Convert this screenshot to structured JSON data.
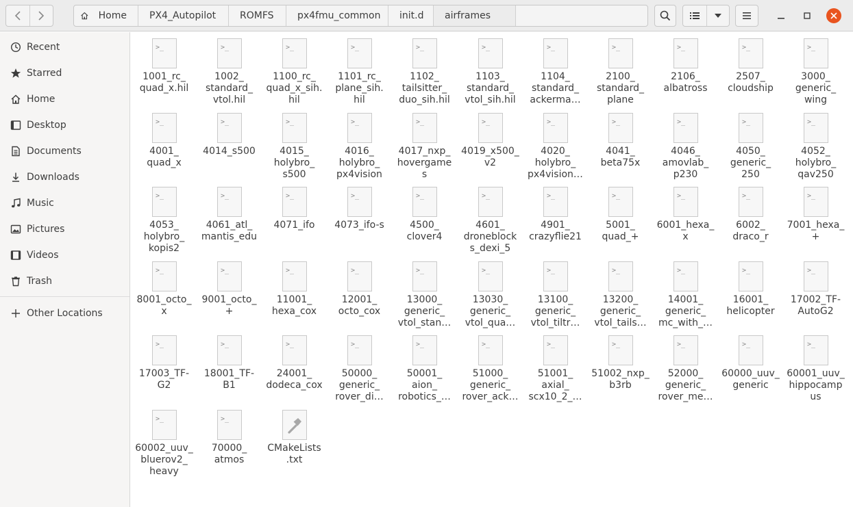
{
  "toolbar": {
    "back_label": "Back",
    "forward_label": "Forward"
  },
  "breadcrumbs": [
    "Home",
    "PX4_Autopilot",
    "ROMFS",
    "px4fmu_common",
    "init.d",
    "airframes"
  ],
  "sidebar": {
    "items": [
      {
        "label": "Recent",
        "icon": "clock-icon"
      },
      {
        "label": "Starred",
        "icon": "star-icon"
      },
      {
        "label": "Home",
        "icon": "home-icon"
      },
      {
        "label": "Desktop",
        "icon": "desktop-icon"
      },
      {
        "label": "Documents",
        "icon": "document-icon"
      },
      {
        "label": "Downloads",
        "icon": "download-icon"
      },
      {
        "label": "Music",
        "icon": "music-icon"
      },
      {
        "label": "Pictures",
        "icon": "pictures-icon"
      },
      {
        "label": "Videos",
        "icon": "video-icon"
      },
      {
        "label": "Trash",
        "icon": "trash-icon"
      }
    ],
    "other_locations": "Other Locations"
  },
  "files": [
    "1001_rc_\nquad_x.hil",
    "1002_\nstandard_\nvtol.hil",
    "1100_rc_\nquad_x_sih.\nhil",
    "1101_rc_\nplane_sih.\nhil",
    "1102_\ntailsitter_\nduo_sih.hil",
    "1103_\nstandard_\nvtol_sih.hil",
    "1104_\nstandard_\nackerma…",
    "2100_\nstandard_\nplane",
    "2106_\nalbatross",
    "2507_\ncloudship",
    "3000_\ngeneric_\nwing",
    "4001_\nquad_x",
    "4014_s500",
    "4015_\nholybro_\ns500",
    "4016_\nholybro_\npx4vision",
    "4017_nxp_\nhovergame\ns",
    "4019_x500_\nv2",
    "4020_\nholybro_\npx4vision…",
    "4041_\nbeta75x",
    "4046_\namovlab_\np230",
    "4050_\ngeneric_\n250",
    "4052_\nholybro_\nqav250",
    "4053_\nholybro_\nkopis2",
    "4061_atl_\nmantis_edu",
    "4071_ifo",
    "4073_ifo-s",
    "4500_\nclover4",
    "4601_\ndroneblock\ns_dexi_5",
    "4901_\ncrazyflie21",
    "5001_\nquad_+",
    "6001_hexa_\nx",
    "6002_\ndraco_r",
    "7001_hexa_\n+",
    "8001_octo_\nx",
    "9001_octo_\n+",
    "11001_\nhexa_cox",
    "12001_\nocto_cox",
    "13000_\ngeneric_\nvtol_stan…",
    "13030_\ngeneric_\nvtol_qua…",
    "13100_\ngeneric_\nvtol_tiltr…",
    "13200_\ngeneric_\nvtol_tails…",
    "14001_\ngeneric_\nmc_with_…",
    "16001_\nhelicopter",
    "17002_TF-\nAutoG2",
    "17003_TF-\nG2",
    "18001_TF-\nB1",
    "24001_\ndodeca_cox",
    "50000_\ngeneric_\nrover_di…",
    "50001_\naion_\nrobotics_…",
    "51000_\ngeneric_\nrover_ack…",
    "51001_\naxial_\nscx10_2_…",
    "51002_nxp_\nb3rb",
    "52000_\ngeneric_\nrover_me…",
    "60000_uuv_\ngeneric",
    "60001_uuv_\nhippocamp\nus",
    "60002_uuv_\nbluerov2_\nheavy",
    "70000_\natmos",
    "CMakeLists\n.txt"
  ],
  "colors": {
    "close_button": "#e9541f",
    "header_bg": "#ececec",
    "sidebar_bg": "#f6f5f4"
  }
}
